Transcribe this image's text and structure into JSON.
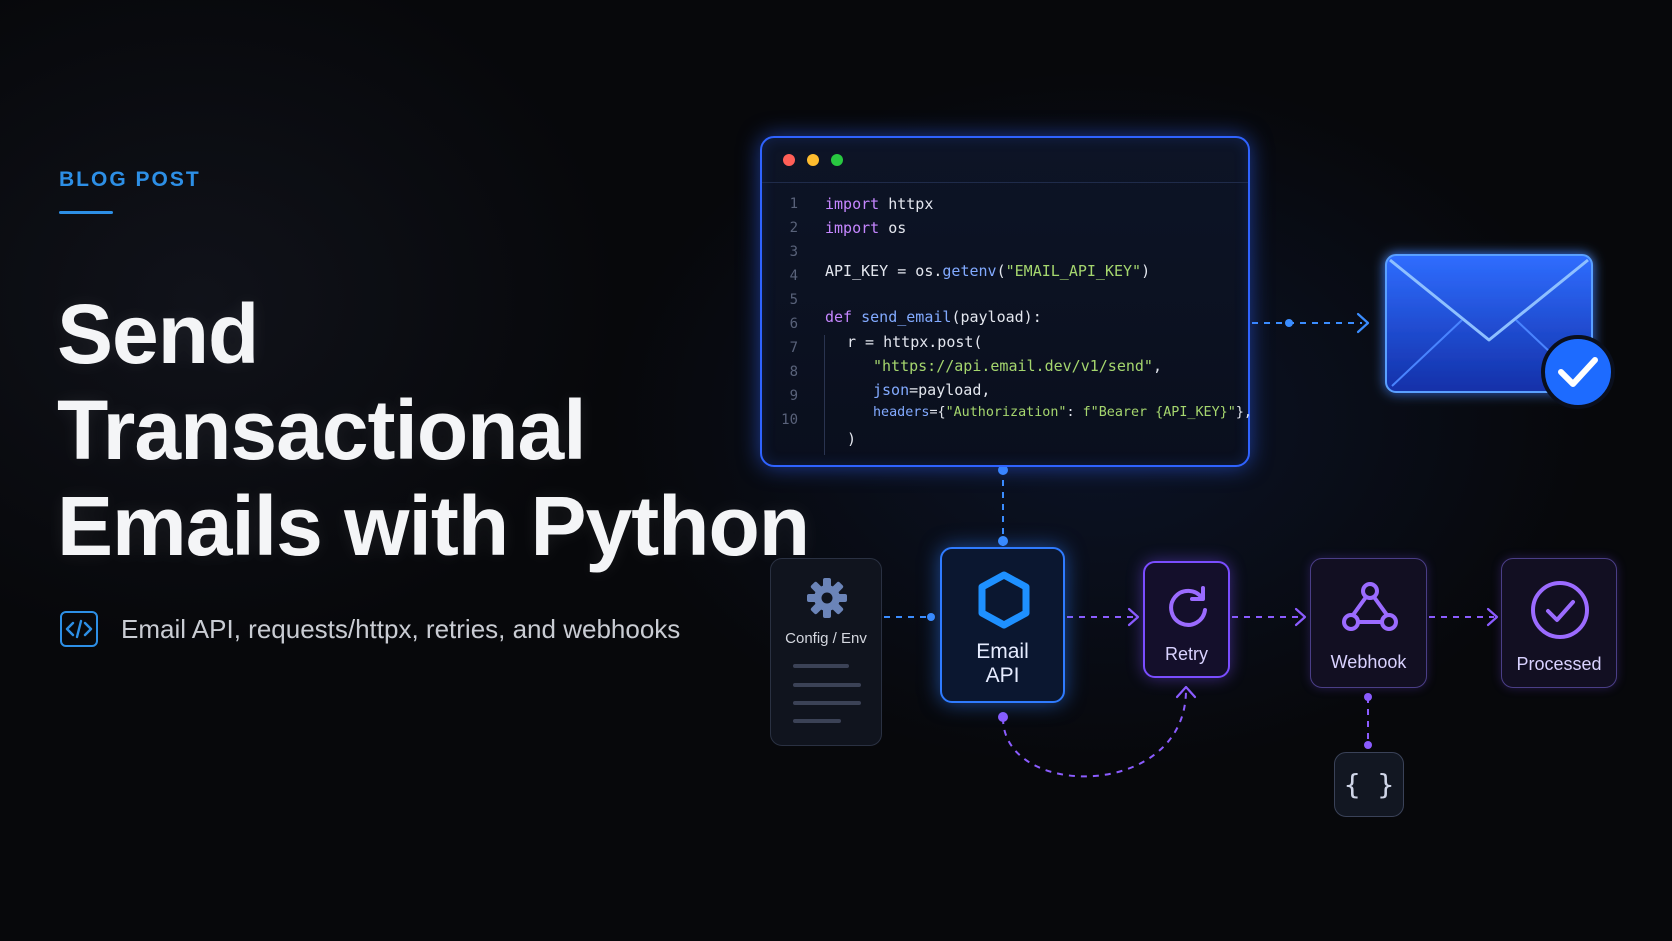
{
  "header": {
    "eyebrow": "BLOG POST",
    "title_lines": [
      "Send",
      "Transactional",
      "Emails with Python"
    ],
    "subtitle": "Email API, requests/httpx, retries, and webhooks"
  },
  "code": {
    "line_numbers": [
      "1",
      "2",
      "3",
      "4",
      "5",
      "6",
      "7",
      "8",
      "9",
      "10"
    ],
    "lines": [
      {
        "kw": "import",
        "rest": " httpx"
      },
      {
        "kw": "import",
        "rest": " os"
      },
      {
        "pre": "API_KEY = os.",
        "fn": "getenv",
        "open": "(",
        "str": "\"EMAIL_API_KEY\"",
        "close": ")"
      },
      {
        "kw": "def",
        "fn": " send_email",
        "rest": "(payload):"
      },
      {
        "text": "r = httpx.post("
      },
      {
        "str": "\"https://api.email.dev/v1/send\"",
        "rest": ","
      },
      {
        "fn": "json",
        "rest": "=payload,"
      },
      {
        "fn": "headers",
        "pre": "={",
        "str": "\"Authorization\"",
        "mid": ": ",
        "str2": "f\"Bearer {API_KEY}\"",
        "rest": "},"
      },
      {
        "text": ")"
      }
    ]
  },
  "pipeline": {
    "config_label": "Config / Env",
    "api_line1": "Email",
    "api_line2": "API",
    "retry_label": "Retry",
    "webhook_label": "Webhook",
    "processed_label": "Processed",
    "json_glyph": "{ }"
  },
  "icons": {
    "subtitle": "code-brackets-icon",
    "config": "gear-icon",
    "api": "hexagon-icon",
    "retry": "refresh-icon",
    "webhook": "webhook-icon",
    "processed": "check-circle-icon",
    "email": "envelope-icon",
    "email_status": "check-badge-icon"
  },
  "colors": {
    "accent_blue": "#2d8fe6",
    "glow_blue": "#2f63ff",
    "accent_purple": "#8b5cff",
    "background": "#07080b"
  }
}
